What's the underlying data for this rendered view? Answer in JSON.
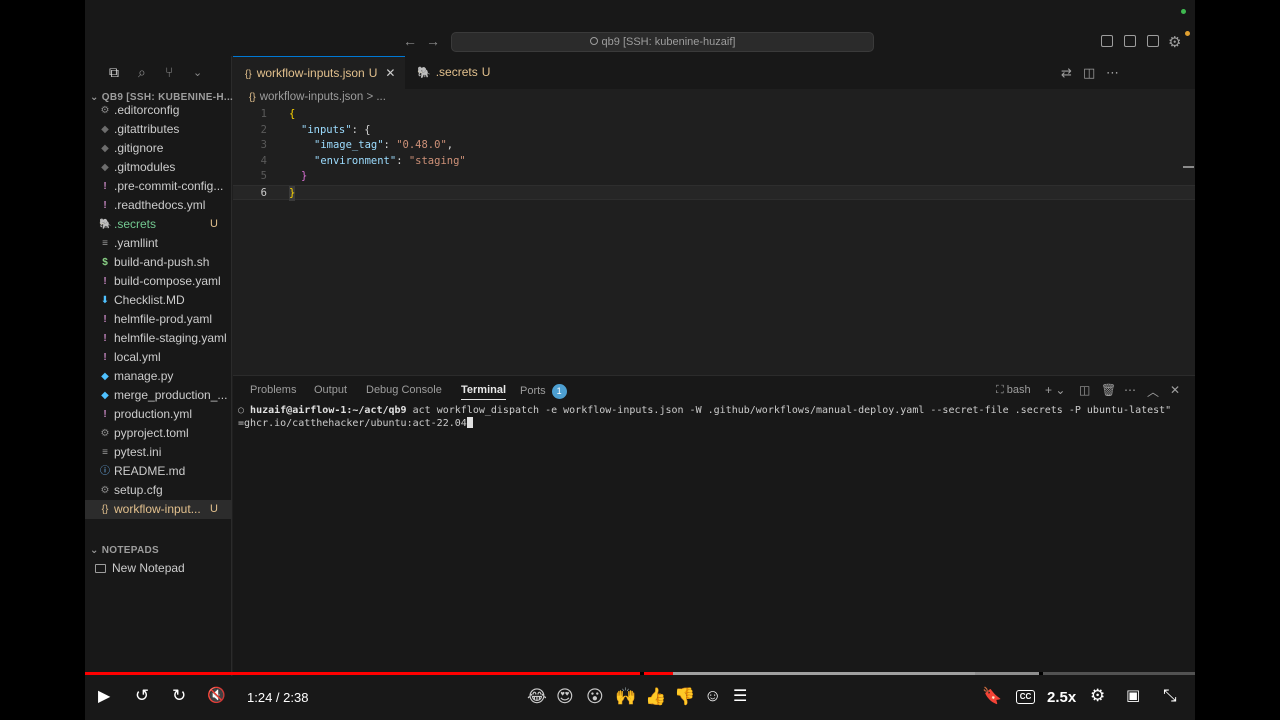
{
  "titlebar": {
    "search_text": "qb9 [SSH: kubenine-huzaif]",
    "back_icon": "←",
    "forward_icon": "→"
  },
  "explorer": {
    "root_label": "QB9 [SSH: KUBENINE-H...",
    "files": [
      {
        "name": ".editorconfig",
        "icon": "gear-icon",
        "glyph": "⚙",
        "status": ""
      },
      {
        "name": ".gitattributes",
        "icon": "git-icon",
        "glyph": "◆",
        "status": ""
      },
      {
        "name": ".gitignore",
        "icon": "git-icon",
        "glyph": "◆",
        "status": ""
      },
      {
        "name": ".gitmodules",
        "icon": "git-icon",
        "glyph": "◆",
        "status": ""
      },
      {
        "name": ".pre-commit-config...",
        "icon": "yaml-icon",
        "glyph": "!",
        "status": ""
      },
      {
        "name": ".readthedocs.yml",
        "icon": "yaml-icon",
        "glyph": "!",
        "status": ""
      },
      {
        "name": ".secrets",
        "icon": "file-icon",
        "glyph": "🐘",
        "status": "U"
      },
      {
        "name": ".yamllint",
        "icon": "lines-icon",
        "glyph": "≡",
        "status": ""
      },
      {
        "name": "build-and-push.sh",
        "icon": "shell-icon",
        "glyph": "$",
        "status": ""
      },
      {
        "name": "build-compose.yaml",
        "icon": "yaml-icon",
        "glyph": "!",
        "status": ""
      },
      {
        "name": "Checklist.MD",
        "icon": "markdown-icon",
        "glyph": "⬇",
        "status": ""
      },
      {
        "name": "helmfile-prod.yaml",
        "icon": "yaml-icon",
        "glyph": "!",
        "status": ""
      },
      {
        "name": "helmfile-staging.yaml",
        "icon": "yaml-icon",
        "glyph": "!",
        "status": ""
      },
      {
        "name": "local.yml",
        "icon": "yaml-icon",
        "glyph": "!",
        "status": ""
      },
      {
        "name": "manage.py",
        "icon": "python-icon",
        "glyph": "◆",
        "status": ""
      },
      {
        "name": "merge_production_...",
        "icon": "python-icon",
        "glyph": "◆",
        "status": ""
      },
      {
        "name": "production.yml",
        "icon": "yaml-icon",
        "glyph": "!",
        "status": ""
      },
      {
        "name": "pyproject.toml",
        "icon": "gear-icon",
        "glyph": "⚙",
        "status": ""
      },
      {
        "name": "pytest.ini",
        "icon": "lines-icon",
        "glyph": "≡",
        "status": ""
      },
      {
        "name": "README.md",
        "icon": "info-icon",
        "glyph": "ⓘ",
        "status": ""
      },
      {
        "name": "setup.cfg",
        "icon": "gear-icon",
        "glyph": "⚙",
        "status": ""
      },
      {
        "name": "workflow-input...",
        "icon": "json-icon",
        "glyph": "{}",
        "status": "U"
      }
    ],
    "notepads_label": "NOTEPADS",
    "new_notepad": "New Notepad"
  },
  "editor": {
    "tabs": [
      {
        "name": "workflow-inputs.json",
        "status": "U",
        "close": "✕"
      },
      {
        "name": ".secrets",
        "status": "U"
      }
    ],
    "breadcrumb": "workflow-inputs.json",
    "breadcrumb_more": "> ...",
    "lines": [
      "1",
      "2",
      "3",
      "4",
      "5",
      "6"
    ],
    "code": {
      "l1": "{",
      "l2_key": "\"inputs\"",
      "l2_rest": ": {",
      "l3_key": "\"image_tag\"",
      "l3_colon": ": ",
      "l3_val": "\"0.48.0\"",
      "l3_comma": ",",
      "l4_key": "\"environment\"",
      "l4_colon": ": ",
      "l4_val": "\"staging\"",
      "l5": "}",
      "l6": "}"
    }
  },
  "panel": {
    "tabs": [
      "Problems",
      "Output",
      "Debug Console",
      "Terminal",
      "Ports"
    ],
    "ports_count": "1",
    "shell": "bash",
    "terminal": {
      "prompt": "huzaif@airflow-1:~/act/qb9",
      "line1": " act workflow_dispatch -e workflow-inputs.json -W .github/workflows/manual-deploy.yaml --secret-file .secrets -P ubuntu-latest\"",
      "line2": "=ghcr.io/catthehacker/ubuntu:act-22.04"
    }
  },
  "player": {
    "time": "1:24 / 2:38",
    "played_fraction": 0.53,
    "speed": "2.5x",
    "emojis": [
      "😂",
      "😍",
      "😮",
      "🙌",
      "👍",
      "👎"
    ]
  }
}
